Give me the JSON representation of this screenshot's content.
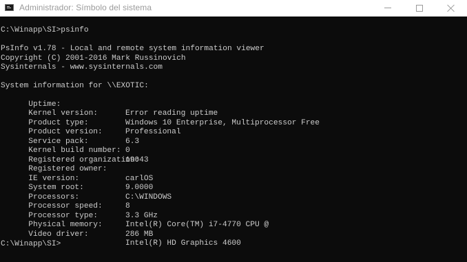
{
  "window": {
    "title": "Administrador: Símbolo del sistema",
    "icon": "console-icon",
    "controls": [
      "minimize-icon",
      "maximize-icon",
      "close-icon"
    ]
  },
  "console": {
    "command_line": "C:\\Winapp\\SI>psinfo",
    "banner": [
      "PsInfo v1.78 - Local and remote system information viewer",
      "Copyright (C) 2001-2016 Mark Russinovich",
      "Sysinternals - www.sysinternals.com"
    ],
    "info_header": "System information for \\\\EXOTIC:",
    "info": [
      {
        "key": "Uptime:",
        "value": "Error reading uptime"
      },
      {
        "key": "Kernel version:",
        "value": "Windows 10 Enterprise, Multiprocessor Free"
      },
      {
        "key": "Product type:",
        "value": "Professional"
      },
      {
        "key": "Product version:",
        "value": "6.3"
      },
      {
        "key": "Service pack:",
        "value": "0"
      },
      {
        "key": "Kernel build number:",
        "value": "19043"
      },
      {
        "key": "Registered organization:",
        "value": ""
      },
      {
        "key": "Registered owner:",
        "value": "carlOS"
      },
      {
        "key": "IE version:",
        "value": "9.0000"
      },
      {
        "key": "System root:",
        "value": "C:\\WINDOWS"
      },
      {
        "key": "Processors:",
        "value": "8"
      },
      {
        "key": "Processor speed:",
        "value": "3.3 GHz"
      },
      {
        "key": "Processor type:",
        "value": "Intel(R) Core(TM) i7-4770 CPU @"
      },
      {
        "key": "Physical memory:",
        "value": "286 MB"
      },
      {
        "key": "Video driver:",
        "value": "Intel(R) HD Graphics 4600"
      }
    ],
    "prompt": "C:\\Winapp\\SI>"
  },
  "colors": {
    "console_background": "#0c0c0c",
    "console_text": "#cccccc",
    "titlebar_background": "#ffffff",
    "titlebar_text": "#9a9a9a"
  }
}
